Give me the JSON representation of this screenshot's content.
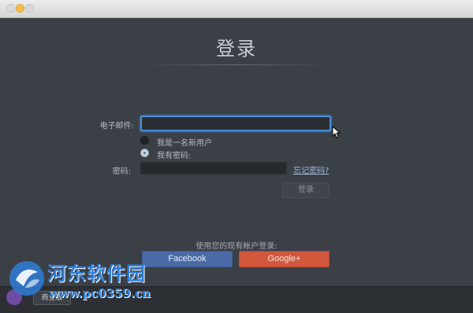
{
  "window": {
    "buttons": [
      "close",
      "minimize",
      "maximize"
    ]
  },
  "login": {
    "title": "登录",
    "email_label": "电子邮件:",
    "email_value": "",
    "option_new_user": "我是一名新用户",
    "option_has_password": "我有密码:",
    "selected_option": "has_password",
    "password_label": "密码:",
    "password_value": "",
    "forgot_password": "忘记密码?",
    "login_button": "登录"
  },
  "social": {
    "label": "使用您的现有帐户登录:",
    "facebook": "Facebook",
    "google": "Google+"
  },
  "footer": {
    "edition_button": "商业版"
  },
  "watermark": {
    "site_name": "河东软件园",
    "url": "www.pc0359.cn"
  },
  "colors": {
    "accent": "#4a90d9",
    "facebook": "#4a6ba8",
    "google": "#d2573c",
    "background": "#3b3f46"
  }
}
